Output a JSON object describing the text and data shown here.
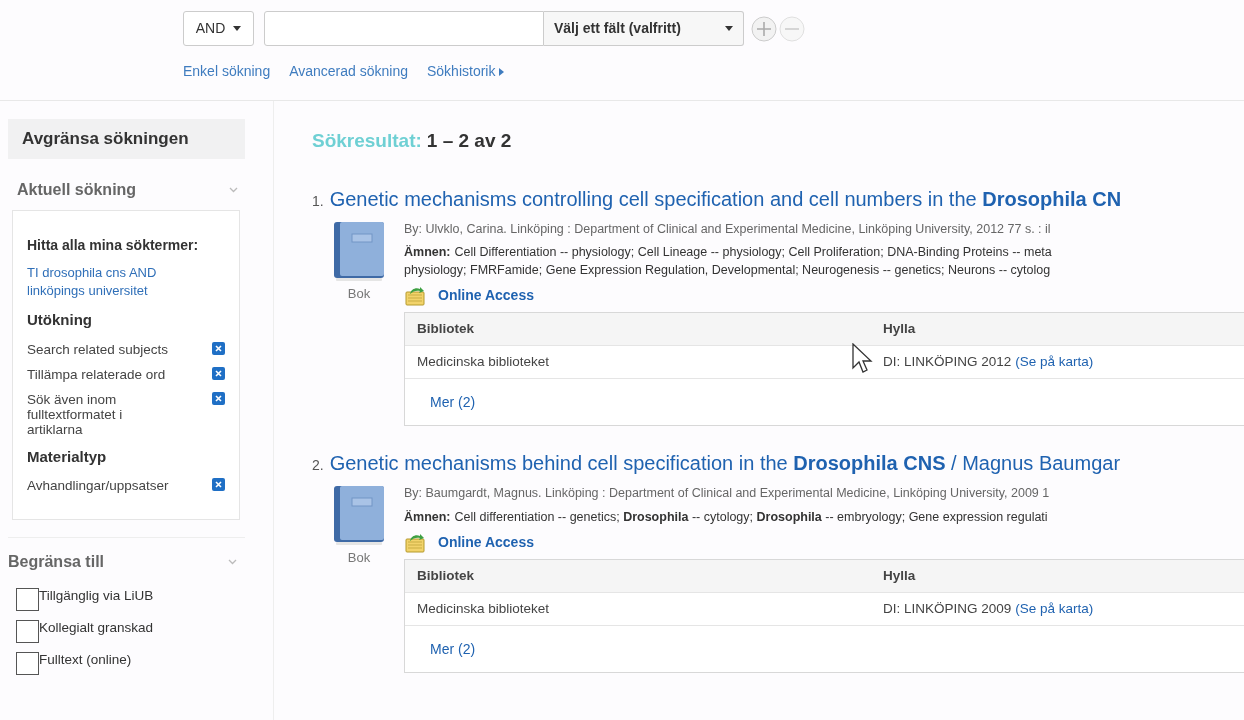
{
  "search_bar": {
    "operator": "AND",
    "field_select": "Välj ett fält (valfritt)",
    "links": [
      {
        "label": "Enkel sökning",
        "kind": "plain"
      },
      {
        "label": "Avancerad sökning",
        "kind": "plain"
      },
      {
        "label": "Sökhistorik",
        "kind": "arrow"
      }
    ]
  },
  "sidebar": {
    "title": "Avgränsa sökningen",
    "current_search": {
      "heading": "Aktuell sökning",
      "find_all_label": "Hitta alla mina söktermer:",
      "query": "TI drosophila cns AND linköpings universitet",
      "groups": [
        {
          "heading": "Utökning",
          "items": [
            "Search related subjects",
            "Tillämpa relaterade ord",
            "Sök även inom fulltextformatet i artiklarna"
          ]
        },
        {
          "heading": "Materialtyp",
          "items": [
            "Avhandlingar/uppsatser"
          ]
        }
      ]
    },
    "limit_to": {
      "heading": "Begränsa till",
      "options": [
        {
          "label": "Tillgänglig via LiUB",
          "checked": false
        },
        {
          "label": "Kollegialt granskad",
          "checked": false
        },
        {
          "label": "Fulltext (online)",
          "checked": false
        }
      ]
    }
  },
  "results": {
    "label": "Sökresultat:",
    "range": "1 – 2 av 2",
    "items": [
      {
        "number": "1.",
        "title": "Genetic mechanisms controlling cell specification and cell numbers in the **Drosophila CN**",
        "type": "Bok",
        "by": "By: Ulvklo, Carina. Linköping : Department of Clinical and Experimental Medicine, Linköping University, 2012 77 s. : il",
        "subjects_label": "Ämnen:",
        "subject_lines": [
          "Cell Differentiation -- physiology; Cell Lineage -- physiology; Cell Proliferation; DNA-Binding Proteins -- meta",
          "physiology; FMRFamide; Gene Expression Regulation, Developmental; Neurogenesis -- genetics; Neurons -- cytolog"
        ],
        "online_access": "Online Access",
        "holdings": {
          "columns": [
            "Bibliotek",
            "Hylla"
          ],
          "rows": [
            {
              "library": "Medicinska biblioteket",
              "shelf": "DI: LINKÖPING 2012",
              "map_link": "(Se på karta)"
            }
          ],
          "more": "Mer (2)"
        }
      },
      {
        "number": "2.",
        "title": "Genetic mechanisms behind cell specification in the **Drosophila CNS** / Magnus Baumgar",
        "type": "Bok",
        "by": "By: Baumgardt, Magnus. Linköping : Department of Clinical and Experimental Medicine, Linköping University, 2009 1",
        "subjects_label": "Ämnen:",
        "subject_lines": [
          "Cell differentiation -- genetics; **Drosophila** -- cytology; **Drosophila** -- embryology; Gene expression regulati"
        ],
        "online_access": "Online Access",
        "holdings": {
          "columns": [
            "Bibliotek",
            "Hylla"
          ],
          "rows": [
            {
              "library": "Medicinska biblioteket",
              "shelf": "DI: LINKÖPING 2009",
              "map_link": "(Se på karta)"
            }
          ],
          "more": "Mer (2)"
        }
      }
    ]
  }
}
